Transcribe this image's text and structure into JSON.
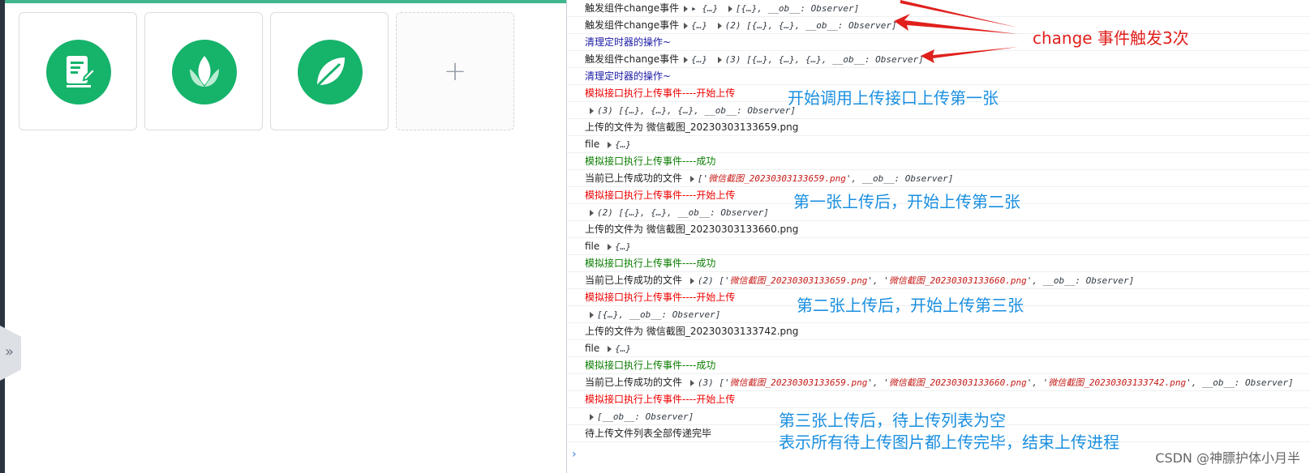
{
  "left_panel": {
    "add_label": "+",
    "icons": [
      "note-edit-icon",
      "lotus-icon",
      "leaf-icon"
    ],
    "collapse_label": "»"
  },
  "console": {
    "rows": [
      {
        "segments": [
          {
            "t": "触发组件change事件",
            "c": "black"
          },
          {
            "t": "▸ {…} ",
            "c": "obj",
            "tri": true
          },
          {
            "t": "[{…}, __ob__: Observer]",
            "c": "obj",
            "tri": true
          }
        ]
      },
      {
        "segments": [
          {
            "t": "触发组件change事件",
            "c": "black"
          },
          {
            "t": "{…} ",
            "c": "obj",
            "tri": true
          },
          {
            "t": "(2) [{…}, {…}, __ob__: Observer]",
            "c": "obj",
            "tri": true
          }
        ]
      },
      {
        "segments": [
          {
            "t": "清理定时器的操作~",
            "c": "blue"
          }
        ]
      },
      {
        "segments": [
          {
            "t": "触发组件change事件",
            "c": "black"
          },
          {
            "t": "{…} ",
            "c": "obj",
            "tri": true
          },
          {
            "t": "(3) [{…}, {…}, {…}, __ob__: Observer]",
            "c": "obj",
            "tri": true
          }
        ]
      },
      {
        "segments": [
          {
            "t": "清理定时器的操作~",
            "c": "blue"
          }
        ]
      },
      {
        "segments": [
          {
            "t": "模拟接口执行上传事件----开始上传",
            "c": "red"
          }
        ]
      },
      {
        "segments": [
          {
            "t": "(3) [{…}, {…}, {…}, __ob__: Observer]",
            "c": "obj",
            "tri": true
          }
        ]
      },
      {
        "segments": [
          {
            "t": "上传的文件为 微信截图_20230303133659.png",
            "c": "black"
          }
        ]
      },
      {
        "segments": [
          {
            "t": "file ",
            "c": "black"
          },
          {
            "t": "{…}",
            "c": "obj",
            "tri": true
          }
        ]
      },
      {
        "segments": [
          {
            "t": "模拟接口执行上传事件----成功",
            "c": "green"
          }
        ]
      },
      {
        "segments": [
          {
            "t": "当前已上传成功的文件 ",
            "c": "black"
          },
          {
            "t": "['",
            "c": "obj",
            "tri": true
          },
          {
            "t": "微信截图_20230303133659.png",
            "c": "str"
          },
          {
            "t": "', __ob__: Observer]",
            "c": "obj"
          }
        ]
      },
      {
        "segments": [
          {
            "t": "模拟接口执行上传事件----开始上传",
            "c": "red"
          }
        ]
      },
      {
        "segments": [
          {
            "t": "(2) [{…}, {…}, __ob__: Observer]",
            "c": "obj",
            "tri": true
          }
        ]
      },
      {
        "segments": [
          {
            "t": "上传的文件为 微信截图_20230303133660.png",
            "c": "black"
          }
        ]
      },
      {
        "segments": [
          {
            "t": "file ",
            "c": "black"
          },
          {
            "t": "{…}",
            "c": "obj",
            "tri": true
          }
        ]
      },
      {
        "segments": [
          {
            "t": "模拟接口执行上传事件----成功",
            "c": "green"
          }
        ]
      },
      {
        "segments": [
          {
            "t": "当前已上传成功的文件 ",
            "c": "black"
          },
          {
            "t": "(2) ['",
            "c": "obj",
            "tri": true
          },
          {
            "t": "微信截图_20230303133659.png",
            "c": "str"
          },
          {
            "t": "', '",
            "c": "obj"
          },
          {
            "t": "微信截图_20230303133660.png",
            "c": "str"
          },
          {
            "t": "', __ob__: Observer]",
            "c": "obj"
          }
        ]
      },
      {
        "segments": [
          {
            "t": "模拟接口执行上传事件----开始上传",
            "c": "red"
          }
        ]
      },
      {
        "segments": [
          {
            "t": "[{…}, __ob__: Observer]",
            "c": "obj",
            "tri": true
          }
        ]
      },
      {
        "segments": [
          {
            "t": "上传的文件为 微信截图_20230303133742.png",
            "c": "black"
          }
        ]
      },
      {
        "segments": [
          {
            "t": "file ",
            "c": "black"
          },
          {
            "t": "{…}",
            "c": "obj",
            "tri": true
          }
        ]
      },
      {
        "segments": [
          {
            "t": "模拟接口执行上传事件----成功",
            "c": "green"
          }
        ]
      },
      {
        "segments": [
          {
            "t": "当前已上传成功的文件 ",
            "c": "black"
          },
          {
            "t": "(3) ['",
            "c": "obj",
            "tri": true
          },
          {
            "t": "微信截图_20230303133659.png",
            "c": "str"
          },
          {
            "t": "', '",
            "c": "obj"
          },
          {
            "t": "微信截图_20230303133660.png",
            "c": "str"
          },
          {
            "t": "', '",
            "c": "obj"
          },
          {
            "t": "微信截图_20230303133742.png",
            "c": "str"
          },
          {
            "t": "', __ob__: Observer]",
            "c": "obj"
          }
        ]
      },
      {
        "segments": [
          {
            "t": "模拟接口执行上传事件----开始上传",
            "c": "red"
          }
        ]
      },
      {
        "segments": [
          {
            "t": "[__ob__: Observer]",
            "c": "obj",
            "tri": true
          }
        ]
      },
      {
        "segments": [
          {
            "t": "待上传文件列表全部传递完毕",
            "c": "black"
          }
        ]
      }
    ],
    "prompt": "›"
  },
  "annotations": {
    "change_note": "change 事件触发3次",
    "first": "开始调用上传接口上传第一张",
    "second": "第一张上传后，开始上传第二张",
    "third": "第二张上传后，开始上传第三张",
    "empty1": "第三张上传后，待上传列表为空",
    "empty2": "表示所有待上传图片都上传完毕，结束上传进程"
  },
  "watermark": "CSDN @神膘护体小月半",
  "colors": {
    "accent_green": "#16b36b",
    "annot_blue": "#1a8fe0",
    "annot_red": "#e0201c"
  }
}
